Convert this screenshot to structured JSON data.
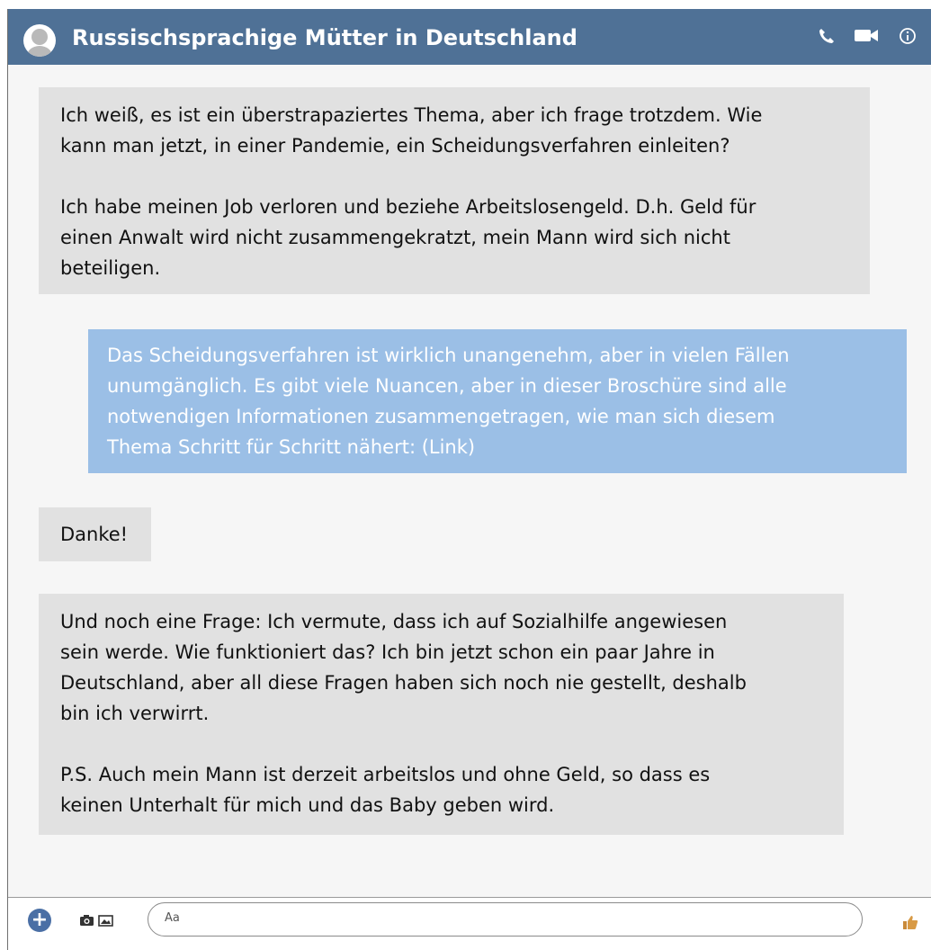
{
  "header": {
    "title": "Russischsprachige Mütter in Deutschland",
    "icons": [
      "avatar-icon",
      "phone-icon",
      "video-icon",
      "info-icon"
    ],
    "accent_color": "#4f7196"
  },
  "messages": [
    {
      "direction": "incoming",
      "text": "Ich weiß, es ist ein überstrapaziertes Thema, aber ich frage trotzdem. Wie\nkann man jetzt, in einer Pandemie, ein Scheidungsverfahren einleiten?\n\nIch habe meinen Job verloren und beziehe Arbeitslosengeld. D.h. Geld für\neinen Anwalt wird nicht zusammengekratzt, mein Mann wird sich nicht\nbeteiligen."
    },
    {
      "direction": "outgoing",
      "text": "Das Scheidungsverfahren ist wirklich unangenehm, aber in vielen Fällen\nunumgänglich. Es gibt viele Nuancen, aber in dieser Broschüre sind alle\nnotwendigen Informationen zusammengetragen, wie man sich diesem\nThema Schritt für Schritt nähert: (Link)"
    },
    {
      "direction": "incoming",
      "text": "Danke!"
    },
    {
      "direction": "incoming",
      "text": "Und noch eine Frage: Ich vermute, dass ich auf Sozialhilfe angewiesen\nsein werde. Wie funktioniert das? Ich bin jetzt schon ein paar Jahre in\nDeutschland, aber all diese Fragen haben sich noch nie gestellt, deshalb\nbin ich verwirrt.\n\nP.S. Auch mein Mann ist derzeit arbeitslos und ohne Geld, so dass es\nkeinen Unterhalt für mich und das Baby geben wird."
    }
  ],
  "composer": {
    "placeholder": "Aa",
    "plus_label": "+",
    "icons": [
      "plus-icon",
      "camera-icon",
      "gallery-icon",
      "like-icon"
    ]
  },
  "colors": {
    "incoming_bubble": "#e1e1e1",
    "outgoing_bubble": "#9bbfe6"
  }
}
